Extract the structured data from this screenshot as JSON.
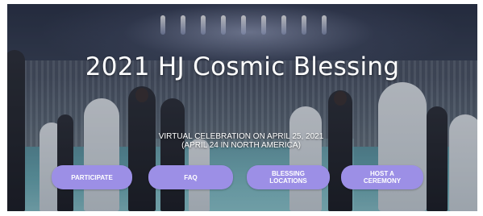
{
  "hero": {
    "title": "2021 HJ Cosmic Blessing",
    "subtitle_line1": "VIRTUAL CELEBRATION ON APRIL 25, 2021",
    "subtitle_line2": "(APRIL 24 IN NORTH AMERICA)"
  },
  "buttons": {
    "participate": "PARTICIPATE",
    "faq": "FAQ",
    "locations": "BLESSING\nLOCATIONS",
    "host": "HOST A\nCEREMONY"
  },
  "colors": {
    "button_bg": "#9c8fe6",
    "button_text": "#ffffff",
    "title_text": "#ffffff"
  }
}
